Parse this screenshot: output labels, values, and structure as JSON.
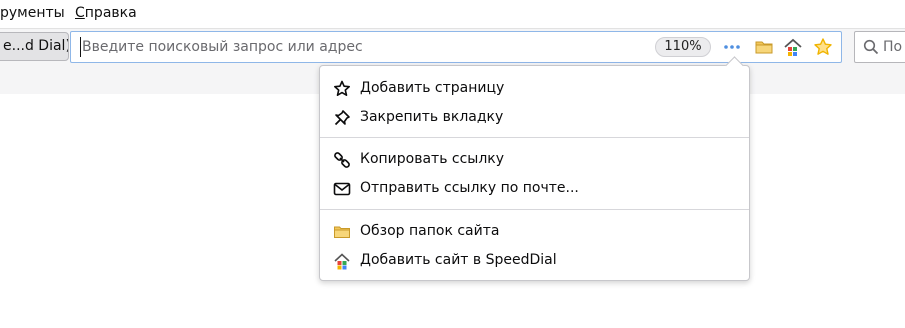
{
  "menubar": {
    "items": [
      {
        "label_pre": "",
        "accel": "",
        "label_post": "рументы"
      },
      {
        "label_pre": "",
        "accel": "С",
        "label_post": "правка"
      }
    ]
  },
  "navbar": {
    "tab_button_label": "e...d Dial)",
    "urlbar": {
      "placeholder": "Введите поисковый запрос или адрес",
      "value": "",
      "zoom": "110%"
    },
    "page_actions": [
      "more-icon",
      "folder-icon",
      "speeddial-icon",
      "bookmark-star-icon"
    ],
    "search": {
      "placeholder": "По"
    }
  },
  "page_action_menu": {
    "items": [
      {
        "label": "Добавить страницу",
        "icon": "star-outline-icon"
      },
      {
        "label": "Закрепить вкладку",
        "icon": "pin-icon"
      },
      {
        "label": "Копировать ссылку",
        "icon": "link-icon"
      },
      {
        "label": "Отправить ссылку по почте...",
        "icon": "mail-icon"
      },
      {
        "label": "Обзор папок сайта",
        "icon": "folder-icon"
      },
      {
        "label": "Добавить сайт в SpeedDial",
        "icon": "speeddial-icon"
      }
    ]
  },
  "colors": {
    "urlbar_focus": "#8fb7e8",
    "folder": "#f2c75a",
    "star": "#f0b400"
  }
}
